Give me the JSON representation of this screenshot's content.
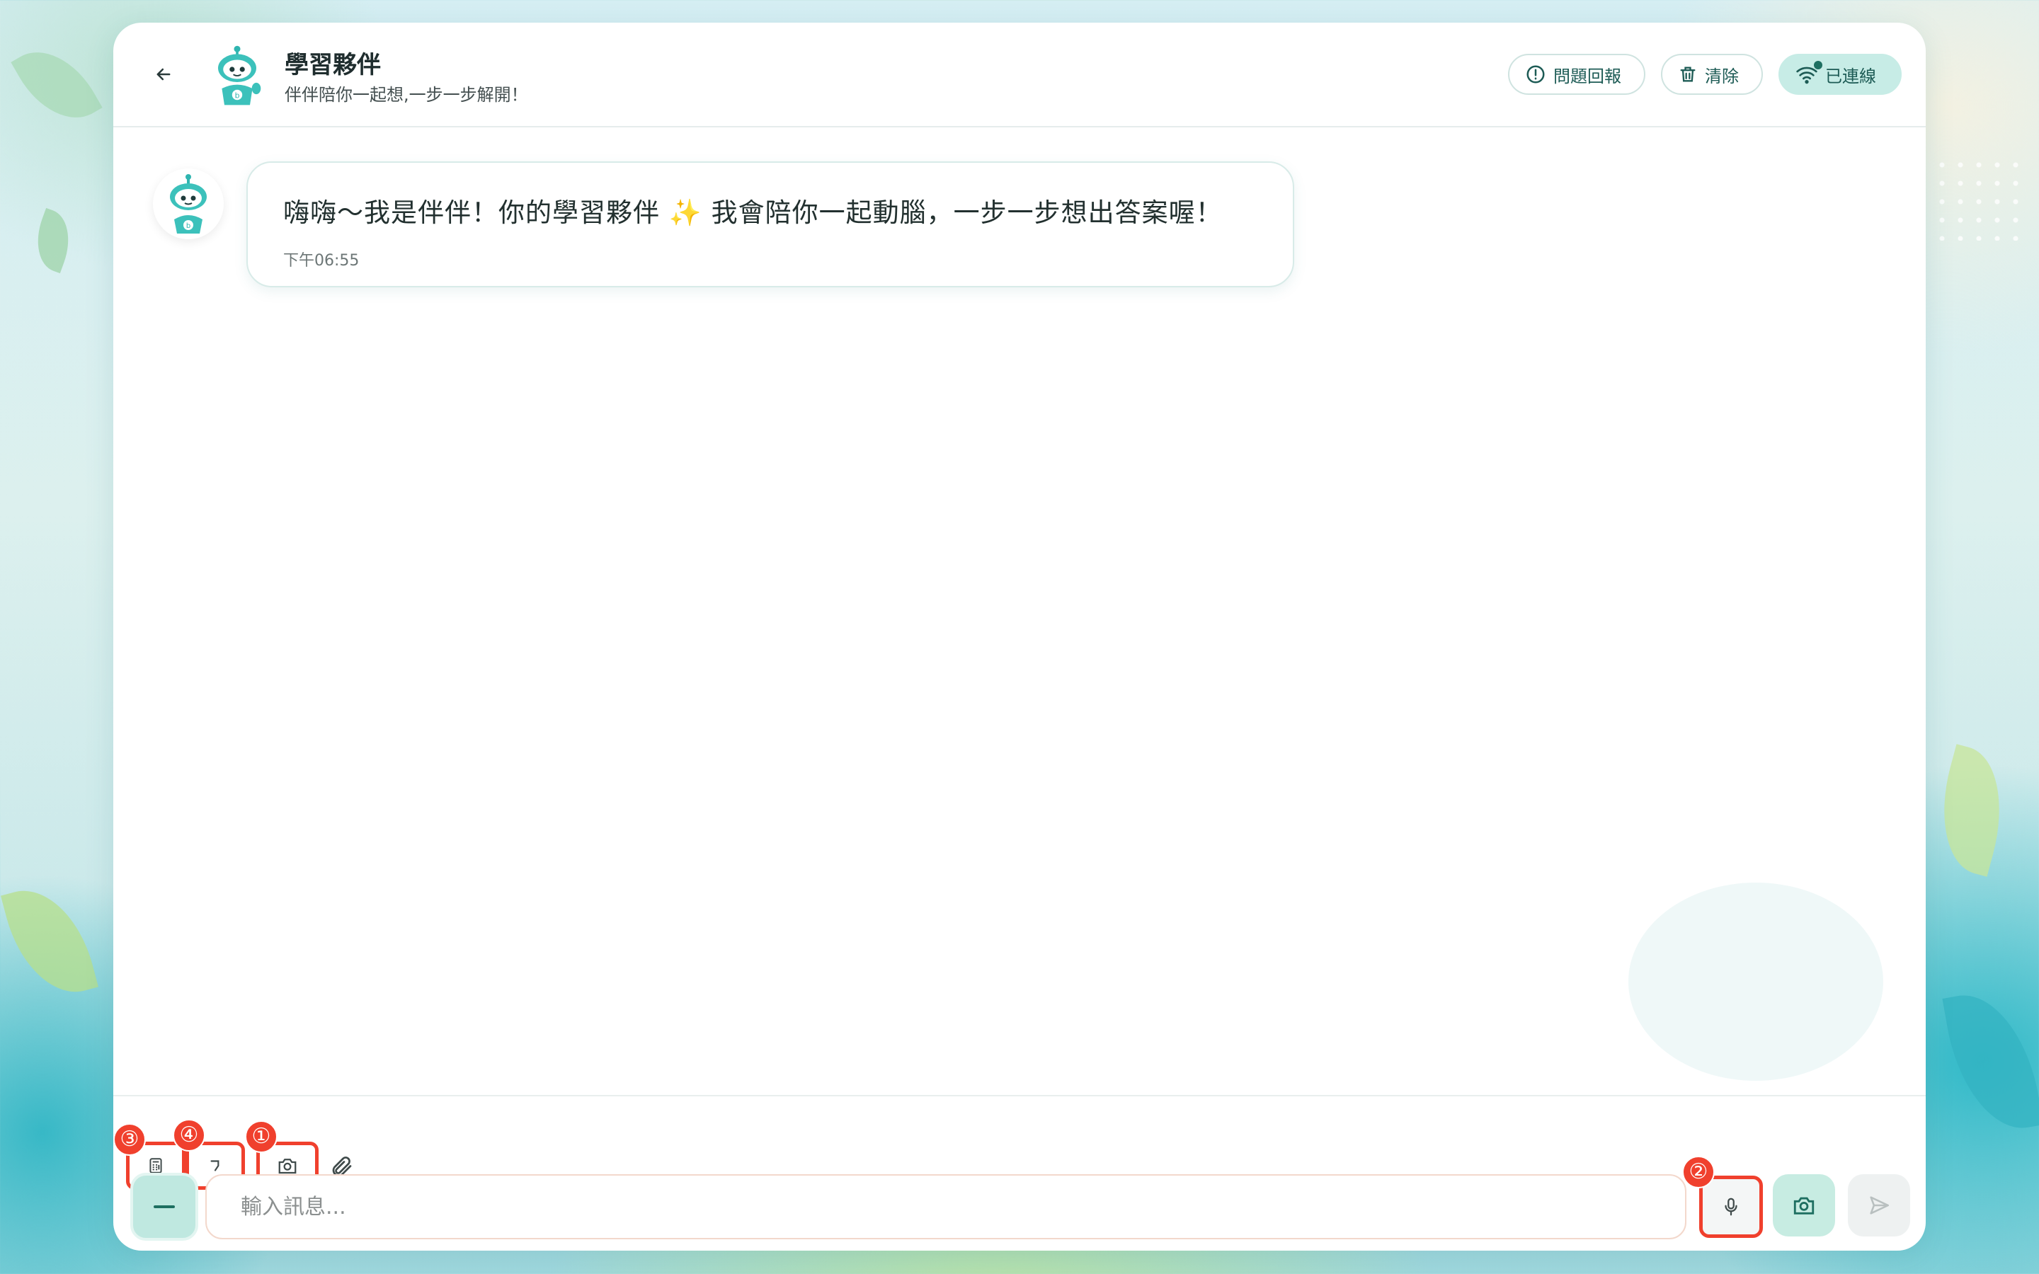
{
  "header": {
    "title": "學習夥伴",
    "subtitle": "伴伴陪你一起想,一步一步解開！",
    "report_label": "問題回報",
    "clear_label": "清除",
    "status_label": "已連線"
  },
  "messages": [
    {
      "sender": "bot",
      "text_before": "嗨嗨～我是伴伴！你的學習夥伴",
      "emoji": "✨",
      "text_after": " 我會陪你一起動腦，一步一步想出答案喔！",
      "time": "下午06:55"
    }
  ],
  "toolbar": {
    "badges": [
      "③",
      "④",
      "①"
    ],
    "icons": [
      "calculator-icon",
      "symbol-icon",
      "camera-icon",
      "paperclip-icon"
    ]
  },
  "composer": {
    "placeholder": "輸入訊息...",
    "mic_badge": "②",
    "icons": [
      "minus-icon",
      "microphone-icon",
      "camera-icon",
      "send-icon"
    ]
  },
  "colors": {
    "accent": "#1e6f61",
    "highlight": "#f0402d",
    "accent_light": "#c7ece6"
  }
}
